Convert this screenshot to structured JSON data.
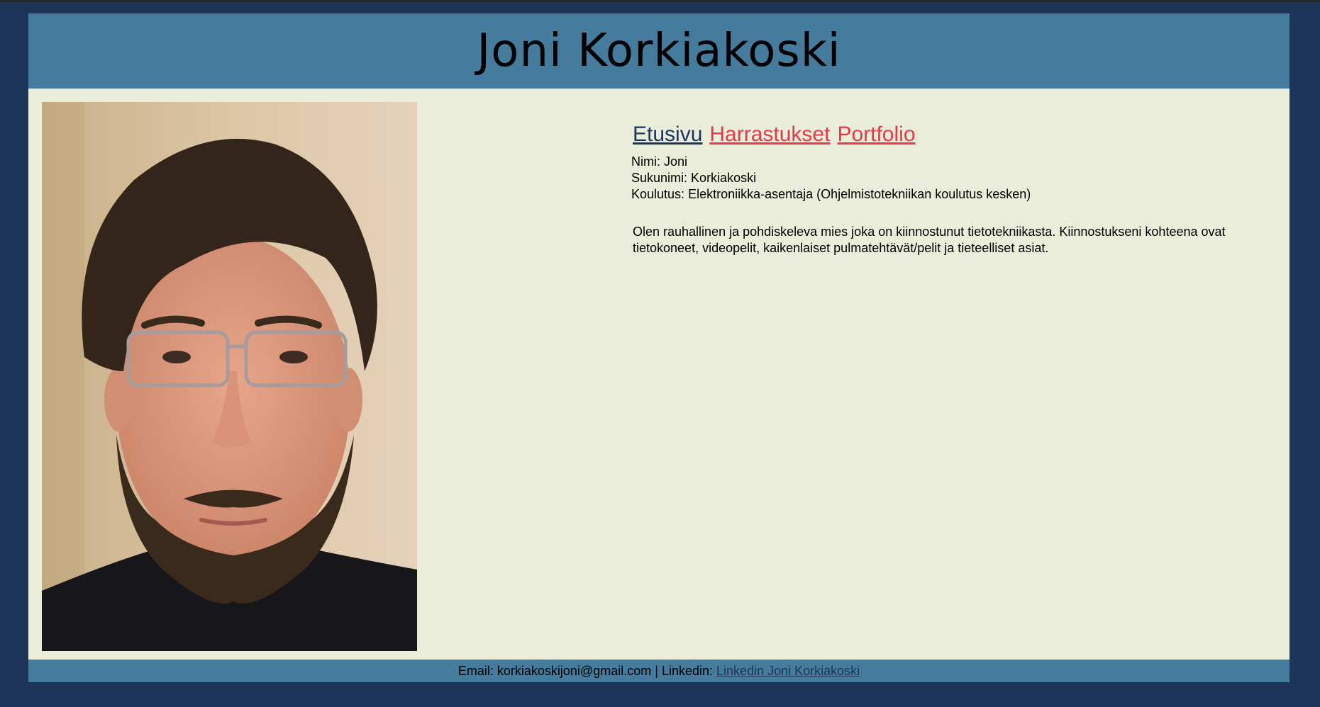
{
  "header": {
    "title": "Joni Korkiakoski"
  },
  "profile": {
    "photo": "profile-photo"
  },
  "nav": {
    "items": [
      {
        "label": "Etusivu",
        "active": true
      },
      {
        "label": "Harrastukset",
        "active": false
      },
      {
        "label": "Portfolio",
        "active": false
      }
    ]
  },
  "info": {
    "name_label": "Nimi:",
    "name_value": "Joni",
    "surname_label": "Sukunimi:",
    "surname_value": "Korkiakoski",
    "education_label": "Koulutus:",
    "education_value": "Elektroniikka-asentaja (Ohjelmistotekniikan koulutus kesken)"
  },
  "about": {
    "text": "Olen rauhallinen ja pohdiskeleva mies joka on kiinnostunut tietotekniikasta. Kiinnostukseni kohteena ovat tietokoneet, videopelit, kaikenlaiset pulmatehtävät/pelit ja tieteelliset asiat."
  },
  "footer": {
    "email_label": "Email:",
    "email": "korkiakoskijoni@gmail.com",
    "separator": "|",
    "linkedin_label": "Linkedin:",
    "linkedin_link": "Linkedin Joni Korkiakoski"
  },
  "colors": {
    "background": "#1c3559",
    "header": "#457b9d",
    "content": "#e9edda",
    "link": "#e63946",
    "active_link": "#1c3559"
  }
}
